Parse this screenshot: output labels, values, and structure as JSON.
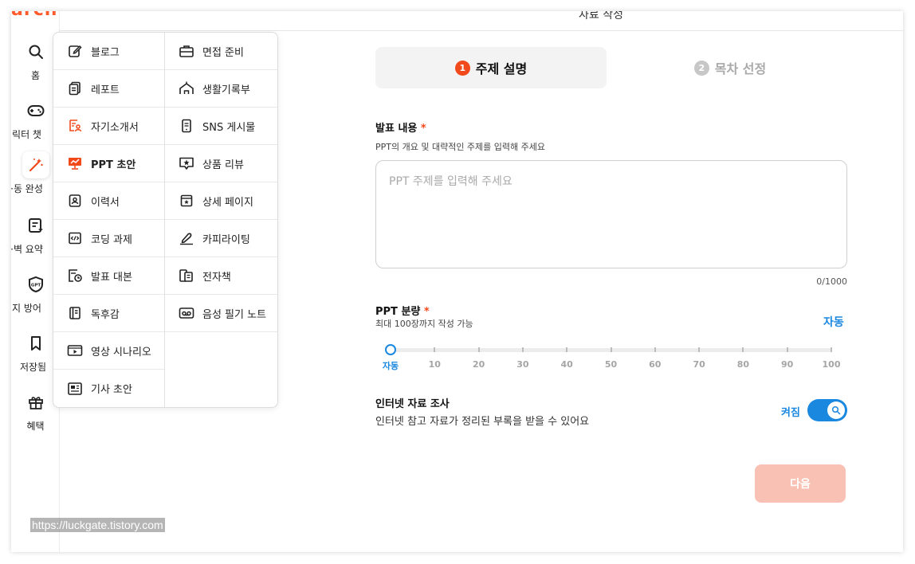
{
  "top": {
    "logo_fragment": "arch",
    "header_fragment": "자료 작성"
  },
  "sidebar": [
    {
      "label": "홈",
      "icon": "search-icon"
    },
    {
      "label": "릭터 챗",
      "icon": "gamepad-icon"
    },
    {
      "label": "·동 완성",
      "icon": "magic-wand-icon",
      "active": true
    },
    {
      "label": "·벽 요약",
      "icon": "summary-icon"
    },
    {
      "label": "지 방어",
      "icon": "gpt-shield-icon"
    },
    {
      "label": "저장됨",
      "icon": "bookmark-icon"
    },
    {
      "label": "혜택",
      "icon": "gift-icon"
    }
  ],
  "menu": {
    "left": [
      {
        "label": "블로그",
        "icon": "edit-icon"
      },
      {
        "label": "레포트",
        "icon": "report-icon"
      },
      {
        "label": "자기소개서",
        "icon": "profile-doc-icon"
      },
      {
        "label": "PPT 초안",
        "icon": "ppt-icon"
      },
      {
        "label": "이력서",
        "icon": "resume-icon"
      },
      {
        "label": "코딩 과제",
        "icon": "code-icon"
      },
      {
        "label": "발표 대본",
        "icon": "script-clock-icon"
      },
      {
        "label": "독후감",
        "icon": "book-icon"
      },
      {
        "label": "영상 시나리오",
        "icon": "video-icon"
      },
      {
        "label": "기사 초안",
        "icon": "news-icon"
      }
    ],
    "right": [
      {
        "label": "면접 준비",
        "icon": "briefcase-icon"
      },
      {
        "label": "생활기록부",
        "icon": "school-icon"
      },
      {
        "label": "SNS 게시물",
        "icon": "phone-icon"
      },
      {
        "label": "상품 리뷰",
        "icon": "star-chat-icon"
      },
      {
        "label": "상세 페이지",
        "icon": "store-star-icon"
      },
      {
        "label": "카피라이팅",
        "icon": "pen-icon"
      },
      {
        "label": "전자책",
        "icon": "ebook-icon"
      },
      {
        "label": "음성 필기 노트",
        "icon": "voice-icon"
      }
    ]
  },
  "steps": [
    {
      "num": "1",
      "label": "주제 설명"
    },
    {
      "num": "2",
      "label": "목차 선정"
    }
  ],
  "topic": {
    "title": "발표 내용",
    "required_mark": "*",
    "subtitle": "PPT의 개요 및 대략적인 주제를 입력해 주세요",
    "value": "",
    "placeholder": "PPT 주제를 입력해 주세요",
    "counter": "0/1000"
  },
  "amount": {
    "title": "PPT 분량",
    "required_mark": "*",
    "subtitle": "최대 100장까지 작성 가능",
    "selected_label": "자동",
    "ticks": [
      "자동",
      "10",
      "20",
      "30",
      "40",
      "50",
      "60",
      "70",
      "80",
      "90",
      "100"
    ],
    "selected_index": 0
  },
  "research": {
    "title": "인터넷 자료 조사",
    "subtitle": "인터넷 참고 자료가 정리된 부록을 받을 수 있어요",
    "toggle_label": "켜짐",
    "enabled": true
  },
  "next_button": "다음",
  "watermark": "https://luckgate.tistory.com",
  "colors": {
    "accent": "#f2491b",
    "blue": "#1b88e0",
    "next_disabled": "#f9c1b4"
  }
}
